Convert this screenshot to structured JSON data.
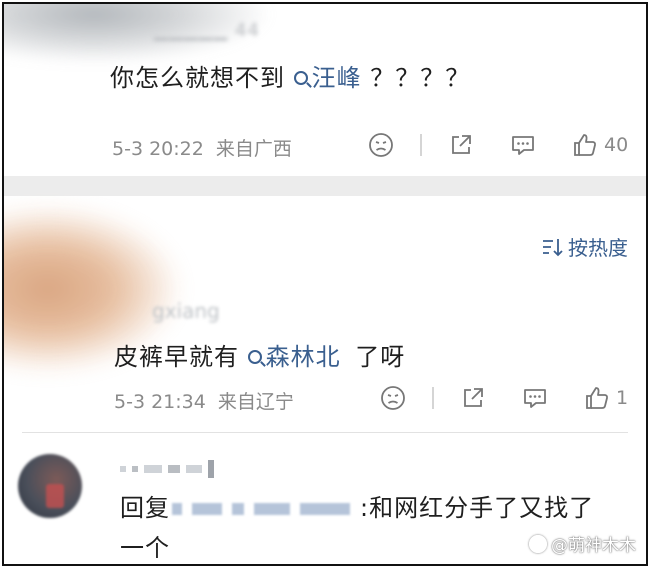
{
  "comment1": {
    "text_before": "你怎么就想不到",
    "topic": "汪峰",
    "text_after": "？？？？",
    "timestamp": "5-3 20:22",
    "location": "来自广西",
    "likes": "40"
  },
  "sort": {
    "label": "按热度"
  },
  "comment2": {
    "username_fragment": "gxiang",
    "text_before": "皮裤早就有",
    "topic": "森林北",
    "text_after": "了呀",
    "timestamp": "5-3 21:34",
    "location": "来自辽宁",
    "likes": "1"
  },
  "reply": {
    "prefix": "回复",
    "text_after": ":和网红分手了又找了",
    "text_line2": "一个"
  },
  "watermark": {
    "text": "@萌神木木"
  },
  "colors": {
    "link": "#3a5f8f",
    "meta": "#8a8a8a",
    "separator": "#ececec"
  },
  "icons": [
    "search-icon",
    "dislike-face-icon",
    "share-icon",
    "comment-icon",
    "thumbs-up-icon",
    "sort-icon"
  ]
}
